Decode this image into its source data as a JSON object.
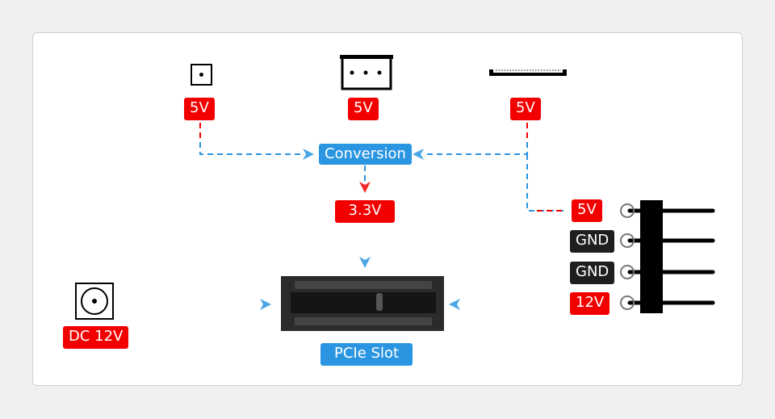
{
  "diagram": {
    "sources": [
      {
        "id": "header-2pin",
        "icon": "single-pin-header-icon",
        "label": "5V"
      },
      {
        "id": "fan-3pin",
        "icon": "3-pin-connector-icon",
        "label": "5V"
      },
      {
        "id": "fpc",
        "icon": "fpc-connector-icon",
        "label": "5V"
      }
    ],
    "conversion_label": "Conversion",
    "output_label": "3.3V",
    "dc_input": {
      "icon": "dc-barrel-jack-icon",
      "label": "DC 12V"
    },
    "pcie_label": "PCIe Slot",
    "power_header_pins": [
      {
        "label": "5V",
        "type": "power"
      },
      {
        "label": "GND",
        "type": "ground"
      },
      {
        "label": "GND",
        "type": "ground"
      },
      {
        "label": "12V",
        "type": "power"
      }
    ],
    "colors": {
      "power": "#f20000",
      "ground": "#1e1e1e",
      "flow": "#2a95e0",
      "node": "#2a95e0"
    }
  }
}
